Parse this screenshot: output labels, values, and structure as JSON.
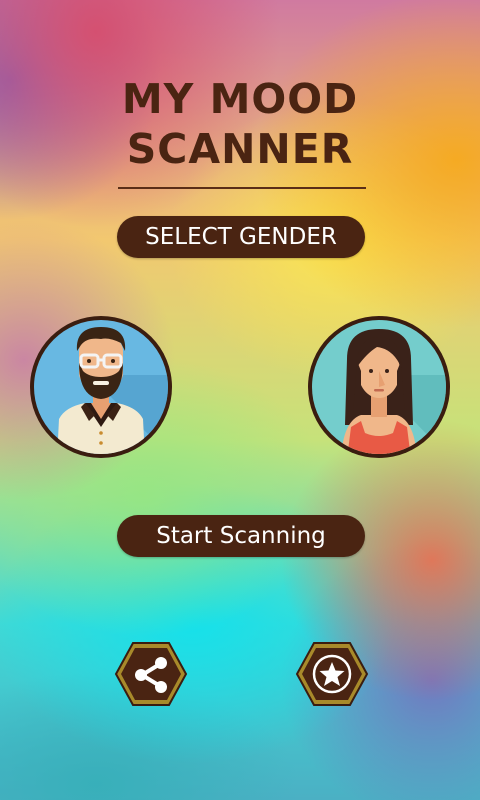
{
  "app": {
    "title_line1": "MY MOOD",
    "title_line2": "SCANNER"
  },
  "labels": {
    "select_gender": "SELECT GENDER",
    "start_scanning": "Start Scanning"
  },
  "avatars": [
    {
      "id": "male",
      "icon": "male-avatar-icon",
      "bg_color": "#5fb3e0"
    },
    {
      "id": "female",
      "icon": "female-avatar-icon",
      "bg_color": "#6bc6c6"
    }
  ],
  "actions": [
    {
      "id": "share",
      "icon": "share-icon"
    },
    {
      "id": "rate",
      "icon": "star-icon"
    }
  ],
  "colors": {
    "brand_dark": "#4a2412",
    "hex_gold": "#a88a2a",
    "text_light": "#ffffff"
  }
}
